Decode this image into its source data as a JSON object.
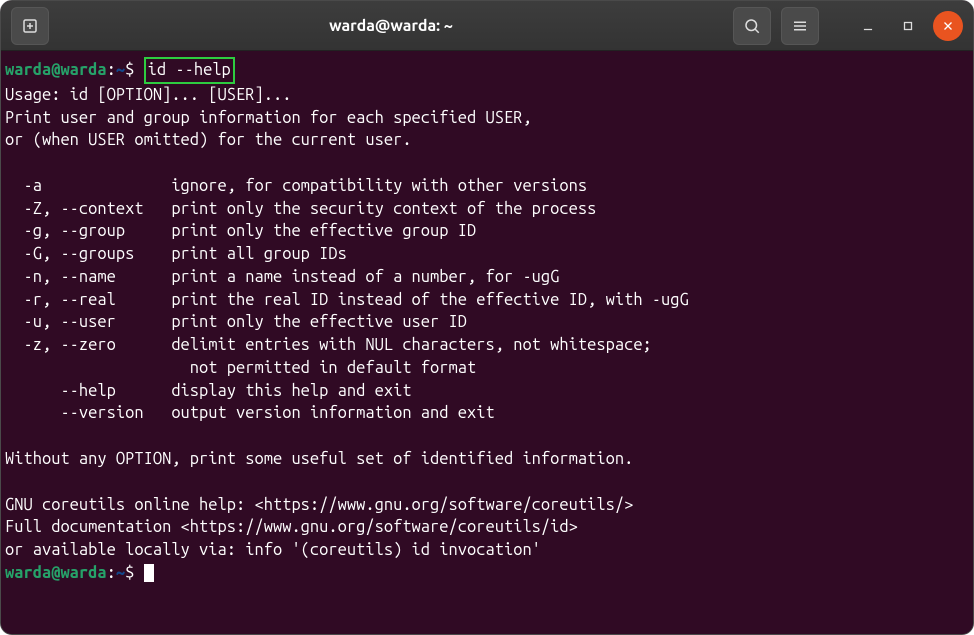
{
  "window": {
    "title": "warda@warda: ~"
  },
  "prompt": {
    "userhost": "warda@warda",
    "sep": ":",
    "path": "~",
    "end": "$"
  },
  "command": "id --help",
  "output": {
    "l1": "Usage: id [OPTION]... [USER]...",
    "l2": "Print user and group information for each specified USER,",
    "l3": "or (when USER omitted) for the current user.",
    "l4": "",
    "l5": "  -a              ignore, for compatibility with other versions",
    "l6": "  -Z, --context   print only the security context of the process",
    "l7": "  -g, --group     print only the effective group ID",
    "l8": "  -G, --groups    print all group IDs",
    "l9": "  -n, --name      print a name instead of a number, for -ugG",
    "l10": "  -r, --real      print the real ID instead of the effective ID, with -ugG",
    "l11": "  -u, --user      print only the effective user ID",
    "l12": "  -z, --zero      delimit entries with NUL characters, not whitespace;",
    "l13": "                    not permitted in default format",
    "l14": "      --help      display this help and exit",
    "l15": "      --version   output version information and exit",
    "l16": "",
    "l17": "Without any OPTION, print some useful set of identified information.",
    "l18": "",
    "l19": "GNU coreutils online help: <https://www.gnu.org/software/coreutils/>",
    "l20": "Full documentation <https://www.gnu.org/software/coreutils/id>",
    "l21": "or available locally via: info '(coreutils) id invocation'"
  }
}
